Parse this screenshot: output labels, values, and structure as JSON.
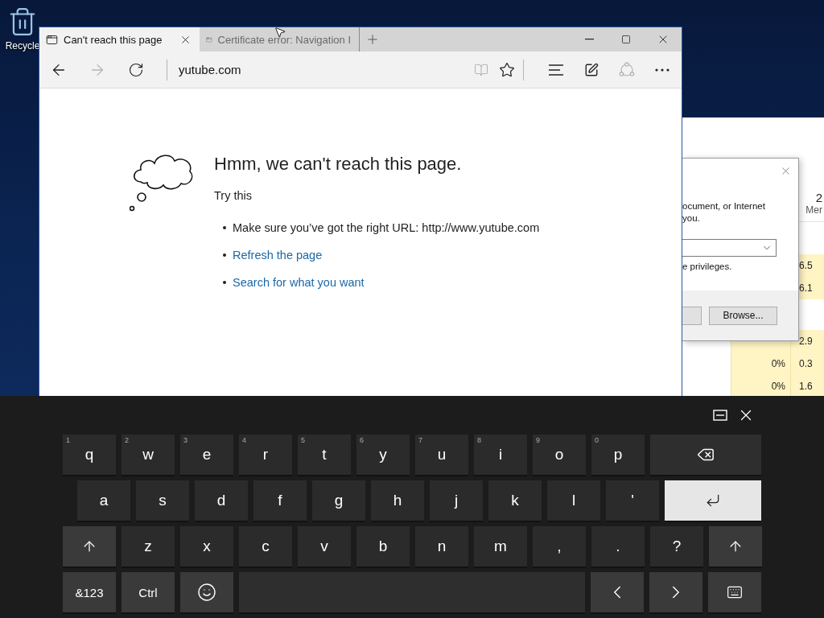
{
  "desktop": {
    "icons": [
      {
        "label": "Recycle"
      }
    ]
  },
  "task_manager": {
    "header_number": "2",
    "header_label": "Mer",
    "groups": [
      {
        "rows": [
          {
            "column_2": "6.5"
          },
          {
            "column_2": "6.1"
          }
        ]
      },
      {
        "rows": [
          {
            "column_2": "2.9"
          },
          {
            "column_1": "0%",
            "column_2": "0.3"
          },
          {
            "column_1": "0%",
            "column_2": "1.6"
          }
        ]
      }
    ]
  },
  "run_dialog": {
    "message": [
      "ocument, or Internet",
      "you."
    ],
    "note": "e privileges.",
    "browse_button": "Browse..."
  },
  "browser": {
    "tabs": [
      {
        "title": "Can't reach this page",
        "selected": true
      },
      {
        "title": "Certificate error: Navigation I",
        "selected": false
      }
    ],
    "nav_buttons": [
      {
        "kind": "back",
        "disabled": false
      },
      {
        "kind": "forward",
        "disabled": true
      },
      {
        "kind": "refresh",
        "disabled": false
      }
    ],
    "address": "yutube.com",
    "tools": [
      {
        "kind": "reading-view",
        "disabled": true
      },
      {
        "kind": "favorite",
        "disabled": false
      },
      {
        "kind": "hub",
        "disabled": false
      },
      {
        "kind": "note",
        "disabled": false
      },
      {
        "kind": "share",
        "disabled": true
      },
      {
        "kind": "more",
        "disabled": false
      }
    ],
    "error_page": {
      "heading": "Hmm, we can't reach this page.",
      "subheading": "Try this",
      "suggestions": [
        {
          "kind": "text",
          "text": "Make sure you’ve got the right URL: http://www.yutube.com"
        },
        {
          "kind": "link",
          "text": "Refresh the page"
        },
        {
          "kind": "link",
          "text": "Search for what you want"
        }
      ]
    }
  },
  "keyboard": {
    "rows": [
      [
        {
          "kind": "letter",
          "label": "q",
          "hint": "1"
        },
        {
          "kind": "letter",
          "label": "w",
          "hint": "2"
        },
        {
          "kind": "letter",
          "label": "e",
          "hint": "3"
        },
        {
          "kind": "letter",
          "label": "r",
          "hint": "4"
        },
        {
          "kind": "letter",
          "label": "t",
          "hint": "5"
        },
        {
          "kind": "letter",
          "label": "y",
          "hint": "6"
        },
        {
          "kind": "letter",
          "label": "u",
          "hint": "7"
        },
        {
          "kind": "letter",
          "label": "i",
          "hint": "8"
        },
        {
          "kind": "letter",
          "label": "o",
          "hint": "9"
        },
        {
          "kind": "letter",
          "label": "p",
          "hint": "0"
        },
        {
          "kind": "backspace"
        }
      ],
      [
        {
          "kind": "letter",
          "label": "a"
        },
        {
          "kind": "letter",
          "label": "s"
        },
        {
          "kind": "letter",
          "label": "d"
        },
        {
          "kind": "letter",
          "label": "f"
        },
        {
          "kind": "letter",
          "label": "g"
        },
        {
          "kind": "letter",
          "label": "h"
        },
        {
          "kind": "letter",
          "label": "j"
        },
        {
          "kind": "letter",
          "label": "k"
        },
        {
          "kind": "letter",
          "label": "l"
        },
        {
          "kind": "letter",
          "label": "'"
        },
        {
          "kind": "enter"
        }
      ],
      [
        {
          "kind": "shift"
        },
        {
          "kind": "letter",
          "label": "z"
        },
        {
          "kind": "letter",
          "label": "x"
        },
        {
          "kind": "letter",
          "label": "c"
        },
        {
          "kind": "letter",
          "label": "v"
        },
        {
          "kind": "letter",
          "label": "b"
        },
        {
          "kind": "letter",
          "label": "n"
        },
        {
          "kind": "letter",
          "label": "m"
        },
        {
          "kind": "letter",
          "label": ","
        },
        {
          "kind": "letter",
          "label": "."
        },
        {
          "kind": "letter",
          "label": "?"
        },
        {
          "kind": "shift"
        }
      ],
      [
        {
          "kind": "function",
          "label": "&123"
        },
        {
          "kind": "function",
          "label": "Ctrl"
        },
        {
          "kind": "emoji"
        },
        {
          "kind": "space"
        },
        {
          "kind": "left"
        },
        {
          "kind": "right"
        },
        {
          "kind": "layout"
        }
      ]
    ]
  }
}
